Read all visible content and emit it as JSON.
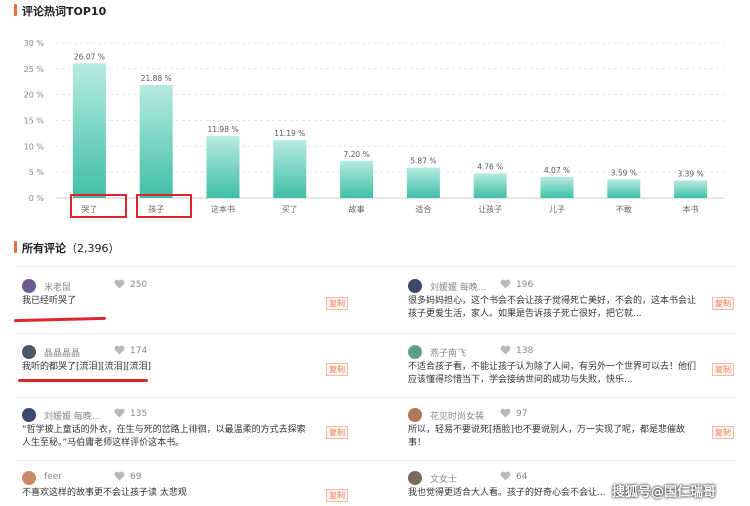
{
  "hot_words": {
    "title": "评论热词TOP10",
    "accent_color": "#f26b3a"
  },
  "chart_data": {
    "type": "bar",
    "title": "",
    "categories": [
      "哭了",
      "孩子",
      "这本书",
      "买了",
      "故事",
      "适合",
      "让孩子",
      "儿子",
      "不敢",
      "本书"
    ],
    "values": [
      26.07,
      21.88,
      11.98,
      11.19,
      7.2,
      5.87,
      4.76,
      4.07,
      3.59,
      3.39
    ],
    "value_labels": [
      "26.07 %",
      "21.88 %",
      "11.98 %",
      "11.19 %",
      "7.20 %",
      "5.87 %",
      "4.76 %",
      "4.07 %",
      "3.59 %",
      "3.39 %"
    ],
    "y_ticks": [
      "0 %",
      "5 %",
      "10 %",
      "15 %",
      "20 %",
      "25 %",
      "30 %"
    ],
    "ylim": [
      0,
      30
    ],
    "grid": true,
    "bar_color": "#7fd8c8",
    "highlighted_categories": [
      "哭了",
      "孩子"
    ]
  },
  "comments": {
    "title": "所有评论",
    "count": "（2,396）",
    "copy_label": "复制",
    "left": [
      {
        "user": "米老鼠",
        "likes": "250",
        "text": "我已经听哭了",
        "avatar_color": "#6b5b8e"
      },
      {
        "user": "晶晶晶晶",
        "likes": "174",
        "text": "我听的都哭了[流泪][流泪][流泪]",
        "avatar_color": "#4a5a6a"
      },
      {
        "user": "刘媛媛 每晚...",
        "likes": "135",
        "text": "“哲学披上童话的外衣，在生与死的岔路上徘徊，以最温柔的方式去探索人生至秘。”马伯庸老师这样评价这本书。",
        "avatar_color": "#3b4a6b"
      },
      {
        "user": "feer",
        "likes": "69",
        "text": "不喜欢这样的故事更不会让孩子读 太悲观",
        "avatar_color": "#c98a6a"
      }
    ],
    "right": [
      {
        "user": "刘媛媛 每晚...",
        "likes": "196",
        "text": "很多妈妈担心，这个书会不会让孩子觉得死亡美好，不会的，这本书会让孩子更爱生活，家人。如果是告诉孩子死亡很好，把它就...",
        "avatar_color": "#3b4a6b"
      },
      {
        "user": "燕子南飞",
        "likes": "138",
        "text": "不适合孩子看，不能让孩子认为除了人间，有另外一个世界可以去！他们应该懂得珍惜当下，学会接纳世间的成功与失败，快乐...",
        "avatar_color": "#5aa08a"
      },
      {
        "user": "花见时尚女装",
        "likes": "97",
        "text": "所以，轻易不要说死[捂脸]也不要说别人，万一实现了呢，都是悲催故事！",
        "avatar_color": "#b07a5a"
      },
      {
        "user": "文女士",
        "likes": "64",
        "text": "我也觉得更适合大人看。孩子的好奇心会不会让...",
        "avatar_color": "#7a6a5a"
      }
    ]
  },
  "watermark": "搜狐号@国仁瑞哥"
}
